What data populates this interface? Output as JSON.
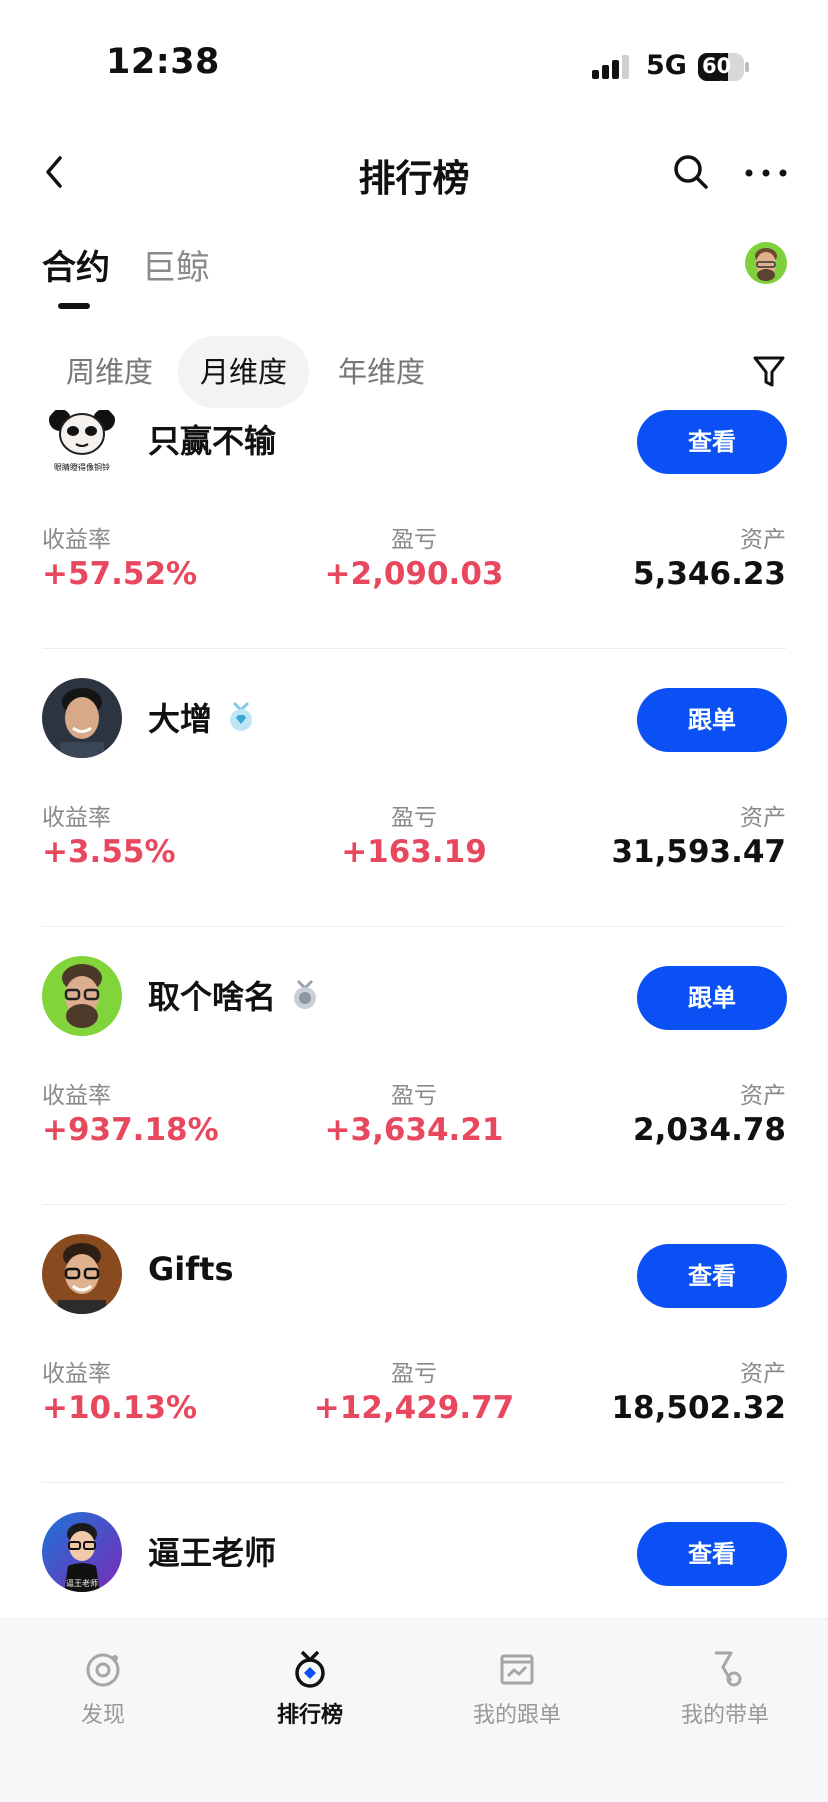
{
  "status_bar": {
    "time": "12:38",
    "network": "5G",
    "battery": "60"
  },
  "header": {
    "title": "排行榜",
    "back_icon": "chevron-left-icon",
    "search_icon": "search-icon",
    "more_icon": "more-horizontal-icon"
  },
  "main_tabs": [
    {
      "label": "合约",
      "active": true
    },
    {
      "label": "巨鲸",
      "active": false
    }
  ],
  "sub_tabs": [
    {
      "label": "周维度",
      "active": false
    },
    {
      "label": "月维度",
      "active": true
    },
    {
      "label": "年维度",
      "active": false
    }
  ],
  "stat_labels": {
    "yield": "收益率",
    "pnl": "盈亏",
    "assets": "资产"
  },
  "traders": [
    {
      "name": "只赢不输",
      "avatar_text": "眼睛瞪得像铜铃",
      "action": "查看",
      "yield": "+57.52%",
      "pnl": "+2,090.03",
      "assets": "5,346.23",
      "badge": null
    },
    {
      "name": "大增",
      "action": "跟单",
      "yield": "+3.55%",
      "pnl": "+163.19",
      "assets": "31,593.47",
      "badge": "diamond-medal-icon"
    },
    {
      "name": "取个啥名",
      "action": "跟单",
      "yield": "+937.18%",
      "pnl": "+3,634.21",
      "assets": "2,034.78",
      "badge": "silver-medal-icon"
    },
    {
      "name": "Gifts",
      "action": "查看",
      "yield": "+10.13%",
      "pnl": "+12,429.77",
      "assets": "18,502.32",
      "badge": null
    },
    {
      "name": "逼王老师",
      "avatar_text": "逼王老师",
      "action": "查看",
      "yield": "",
      "pnl": "",
      "assets": "",
      "badge": null
    }
  ],
  "bottom_nav": [
    {
      "label": "发现",
      "icon": "discover-icon",
      "active": false
    },
    {
      "label": "排行榜",
      "icon": "ranking-medal-icon",
      "active": true
    },
    {
      "label": "我的跟单",
      "icon": "copy-trade-chart-icon",
      "active": false
    },
    {
      "label": "我的带单",
      "icon": "lead-trade-icon",
      "active": false
    }
  ],
  "colors": {
    "accent": "#0a50f5",
    "positive": "#e8485d",
    "text": "#111111",
    "muted": "#8a8a8a"
  }
}
